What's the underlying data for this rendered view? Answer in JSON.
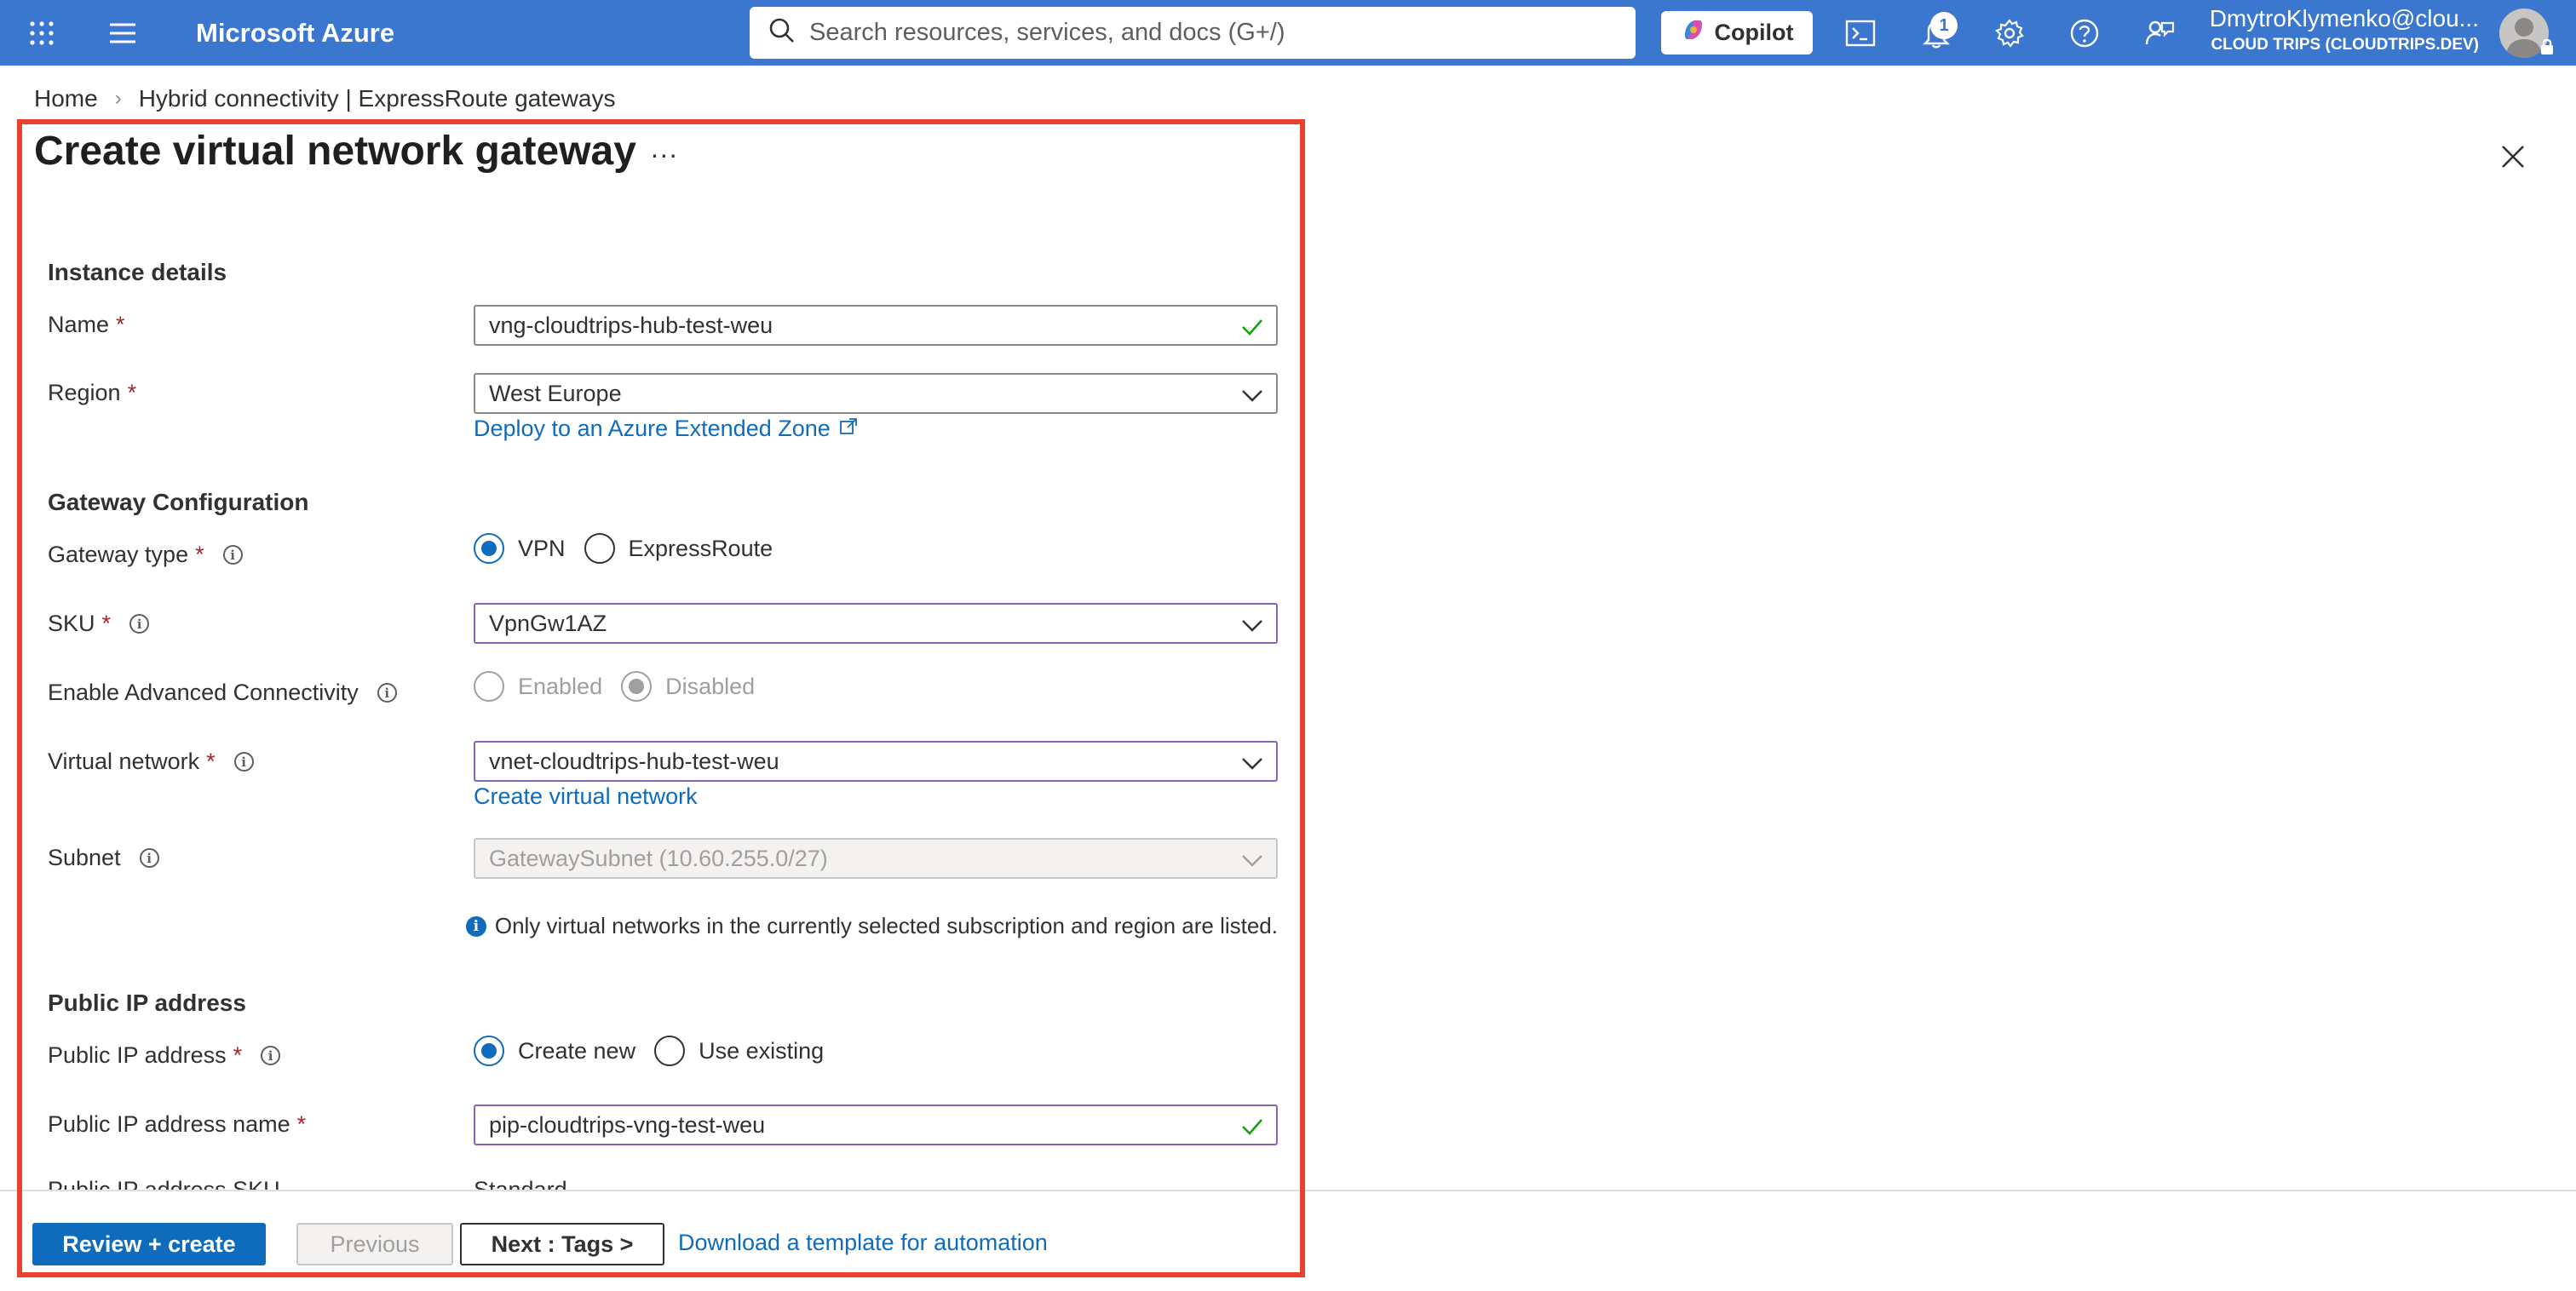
{
  "topbar": {
    "brand": "Microsoft Azure",
    "search_placeholder": "Search resources, services, and docs (G+/)",
    "copilot_label": "Copilot",
    "notifications_count": "1",
    "user": "DmytroKlymenko@clou...",
    "tenant": "CLOUD TRIPS (CLOUDTRIPS.DEV)",
    "bg_color": "#3b77cf"
  },
  "breadcrumb": {
    "home": "Home",
    "current": "Hybrid connectivity | ExpressRoute gateways"
  },
  "page": {
    "title": "Create virtual network gateway",
    "more": "...",
    "highlight_color": "#e8412c"
  },
  "instance": {
    "heading": "Instance details",
    "name_label": "Name",
    "name_value": "vng-cloudtrips-hub-test-weu",
    "region_label": "Region",
    "region_value": "West Europe",
    "extended_zone_link": "Deploy to an Azure Extended Zone"
  },
  "gateway": {
    "heading": "Gateway Configuration",
    "type_label": "Gateway type",
    "type_options": [
      "VPN",
      "ExpressRoute"
    ],
    "type_selected": "VPN",
    "sku_label": "SKU",
    "sku_value": "VpnGw1AZ",
    "adv_label": "Enable Advanced Connectivity",
    "adv_options": [
      "Enabled",
      "Disabled"
    ],
    "adv_selected": "Disabled",
    "vnet_label": "Virtual network",
    "vnet_value": "vnet-cloudtrips-hub-test-weu",
    "create_vnet_link": "Create virtual network",
    "subnet_label": "Subnet",
    "subnet_value": "GatewaySubnet (10.60.255.0/27)",
    "note": "Only virtual networks in the currently selected subscription and region are listed."
  },
  "public_ip": {
    "heading": "Public IP address",
    "ip_label": "Public IP address",
    "ip_options": [
      "Create new",
      "Use existing"
    ],
    "ip_selected": "Create new",
    "name_label": "Public IP address name",
    "name_value": "pip-cloudtrips-vng-test-weu",
    "sku_label": "Public IP address SKU",
    "sku_value": "Standard"
  },
  "footer": {
    "review": "Review + create",
    "previous": "Previous",
    "next": "Next : Tags >",
    "template_link": "Download a template for automation"
  },
  "colors": {
    "accent": "#0f6cbd",
    "required": "#a4262c",
    "valid": "#13a10e",
    "focus_border": "#8764b8"
  }
}
